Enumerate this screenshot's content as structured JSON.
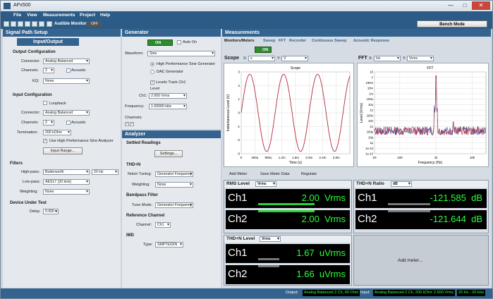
{
  "app": {
    "title": "APx500",
    "min": "—",
    "max": "□",
    "close": "✕"
  },
  "menu": [
    "File",
    "View",
    "Measurements",
    "Project",
    "Help"
  ],
  "toolbar": {
    "audible_monitor": "Audible Monitor",
    "off": "OFF",
    "mode": "Bench Mode"
  },
  "signal_path": {
    "title": "Signal Path Setup",
    "selector": "Input/Output",
    "output_config": "Output Configuration",
    "connector_lbl": "Connector:",
    "connector_val": "Analog Balanced",
    "channels_lbl": "Channels:",
    "channels_val": "2",
    "acoustic": "Acoustic",
    "eq_lbl": "EQ:",
    "eq_val": "None",
    "input_config": "Input Configuration",
    "loopback": "Loopback",
    "in_connector_val": "Analog Balanced",
    "in_channels_val": "2",
    "termination_lbl": "Termination:",
    "termination_val": "200 kOhm",
    "hp_sine": "Use High Performance Sine Analyzer",
    "input_range": "Input Range...",
    "filters": "Filters",
    "highpass_lbl": "High-pass:",
    "highpass_val": "Butterworth",
    "highpass_freq": "20 Hz",
    "lowpass_lbl": "Low-pass:",
    "lowpass_val": "AES17 (20 kHz)",
    "weighting_lbl": "Weighting:",
    "weighting_val": "None",
    "dut": "Device Under Test",
    "delay_lbl": "Delay:",
    "delay_val": "0.000 s"
  },
  "generator": {
    "title": "Generator",
    "on": "ON",
    "auto_on": "Auto On",
    "waveform_lbl": "Waveform:",
    "waveform_val": "Sine",
    "hp_sine_gen": "High Performance Sine Generator",
    "dac_gen": "DAC Generator",
    "levels_track": "Levels Track Ch1",
    "level_lbl": "Level",
    "ch1_lbl": "Ch1:",
    "ch1_val": "2.000 Vrms",
    "freq_lbl": "Frequency:",
    "freq_val": "1.00000 kHz",
    "channels_lbl": "Channels:"
  },
  "analyzer": {
    "title": "Analyzer",
    "settled": "Settled Readings",
    "settings": "Settings...",
    "thdn": "THD+N",
    "notch_lbl": "Notch Tuning:",
    "notch_val": "Generator Frequency",
    "weighting_lbl": "Weighting:",
    "weighting_val": "None",
    "bandpass": "Bandpass Filter",
    "tune_lbl": "Tune Mode:",
    "tune_val": "Generator Frequency",
    "ref_channel": "Reference Channel",
    "channel_lbl": "Channel:",
    "channel_val": "Ch1",
    "imd": "IMD",
    "type_lbl": "Type:",
    "type_val": "SMPTE/DIN"
  },
  "measurements": {
    "title": "Measurements",
    "tabs": [
      "Monitors/Meters",
      "Sweep",
      "FFT",
      "Recorder",
      "Continuous Sweep",
      "Acoustic Response"
    ],
    "on": "ON",
    "scope": {
      "title": "Scope",
      "x_lbl": "X:",
      "x_val": "s",
      "y_lbl": "Y:",
      "y_val": "V",
      "plot_title": "Scope",
      "xlabel": "Time (s)",
      "ylabel": "Instantaneous Level (V)",
      "xticks": [
        "0",
        "400u",
        "800u",
        "1.2m",
        "1.6m",
        "2.0m",
        "2.4m",
        "2.8m"
      ],
      "yticks": [
        "3",
        "2",
        "1",
        "0",
        "-1",
        "-2",
        "-3"
      ]
    },
    "fft": {
      "title": "FFT",
      "x_lbl": "X:",
      "x_val": "Hz",
      "y_lbl": "Y:",
      "y_val": "Vrms",
      "plot_title": "FFT",
      "xlabel": "Frequency (Hz)",
      "ylabel": "Level (Vrms)",
      "xticks": [
        "20",
        "100",
        "1k",
        "10k"
      ],
      "yticks": [
        "10",
        "1",
        "100m",
        "10m",
        "1m",
        "100u",
        "10u",
        "1u",
        "100n",
        "10n",
        "1n",
        "100p",
        "10p",
        "1p",
        "1e-13",
        "1e-14"
      ]
    },
    "meters_toolbar": {
      "add_meter": "Add Meter",
      "save": "Save Meter Data",
      "regulate": "Regulate"
    },
    "rms": {
      "title": "RMS Level",
      "unit_sel": "Vrms",
      "ch1": "Ch1",
      "ch1_val": "2.00",
      "ch1_unit": "Vrms",
      "ch2": "Ch2",
      "ch2_val": "2.00",
      "ch2_unit": "Vrms"
    },
    "thdn_ratio": {
      "title": "THD+N Ratio",
      "unit_sel": "dB",
      "ch1": "Ch1",
      "ch1_val": "-121.585",
      "ch1_unit": "dB",
      "ch2": "Ch2",
      "ch2_val": "-121.644",
      "ch2_unit": "dB"
    },
    "thdn_level": {
      "title": "THD+N Level",
      "unit_sel": "Vrms",
      "ch1": "Ch1",
      "ch1_val": "1.67",
      "ch1_unit": "uVrms",
      "ch2": "Ch2",
      "ch2_val": "1.66",
      "ch2_unit": "uVrms"
    },
    "add_meter": "Add meter..."
  },
  "status": {
    "output_lbl": "Output:",
    "output_val": "Analog Balanced 2 Ch, 40 Ohm",
    "input_lbl": "Input:",
    "input_val": "Analog Balanced 2 Ch, 200 kOhm",
    "level_val": "2.500 Vrms",
    "bw_val": "20 Hz - 20 kHz"
  }
}
